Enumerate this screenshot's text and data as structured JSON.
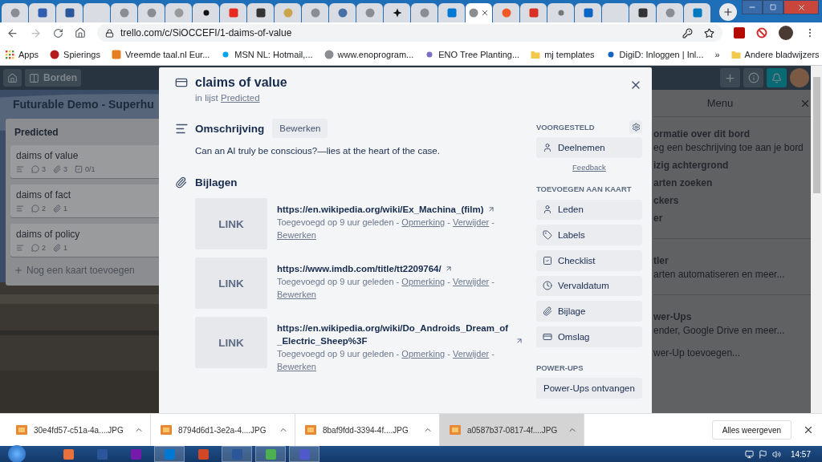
{
  "browser": {
    "tabs": [
      {
        "selected": false
      },
      {
        "selected": false
      },
      {
        "selected": false
      },
      {
        "selected": false
      },
      {
        "selected": false
      },
      {
        "selected": false
      },
      {
        "selected": false
      },
      {
        "selected": false
      },
      {
        "selected": false
      },
      {
        "selected": false
      },
      {
        "selected": false
      },
      {
        "selected": false
      },
      {
        "selected": false
      },
      {
        "selected": false
      },
      {
        "selected": false
      },
      {
        "selected": false
      },
      {
        "selected": false
      },
      {
        "selected": true
      },
      {
        "selected": false
      },
      {
        "selected": false
      },
      {
        "selected": false
      },
      {
        "selected": false
      },
      {
        "selected": false
      },
      {
        "selected": false
      },
      {
        "selected": false
      },
      {
        "selected": false
      }
    ],
    "url": "trello.com/c/SiOCCEFI/1-daims-of-value",
    "bookmarks": [
      "Apps",
      "Spierings",
      "Vreemde taal.nl Eur...",
      "MSN NL: Hotmail,...",
      "www.enoprogram...",
      "ENO Tree Planting...",
      "mj templates",
      "DigiD: Inloggen | Inl..."
    ],
    "more": "»",
    "other_bookmarks": "Andere bladwijzers"
  },
  "board": {
    "nav": {
      "boards": "Borden"
    },
    "title": "Futurable Demo - Superhu",
    "list": {
      "title": "Predicted",
      "cards": [
        {
          "title": "daims of value",
          "badges": [
            {
              "kind": "description"
            },
            {
              "kind": "comments",
              "count": "3"
            },
            {
              "kind": "attachments",
              "count": "3"
            },
            {
              "kind": "checklist",
              "count": "0/1"
            }
          ]
        },
        {
          "title": "daims of fact",
          "badges": [
            {
              "kind": "description"
            },
            {
              "kind": "comments",
              "count": "2"
            },
            {
              "kind": "attachments",
              "count": "1"
            }
          ]
        },
        {
          "title": "daims of policy",
          "badges": [
            {
              "kind": "description"
            },
            {
              "kind": "comments",
              "count": "2"
            },
            {
              "kind": "attachments",
              "count": "1"
            }
          ]
        }
      ],
      "add_card": "Nog een kaart toevoegen"
    }
  },
  "menu": {
    "title": "Menu",
    "sections": [
      {
        "items": [
          {
            "title": "ormatie over dit bord",
            "subtitle": "eg een beschrijving toe aan je bord"
          },
          {
            "title": "izig achtergrond"
          },
          {
            "title": "arten zoeken"
          },
          {
            "title": "ckers"
          },
          {
            "title": "er"
          }
        ]
      },
      {
        "items": [
          {
            "title": "tler",
            "subtitle": "arten automatiseren en meer..."
          }
        ]
      },
      {
        "items": [
          {
            "title": "wer-Ups",
            "subtitle": "ender, Google Drive en meer...",
            "extra": "wer-Up toevoegen..."
          }
        ]
      }
    ]
  },
  "modal": {
    "title": "claims of value",
    "list_prefix": "in lijst",
    "list_link": "Predicted",
    "description": {
      "heading": "Omschrijving",
      "edit": "Bewerken",
      "text": "Can an AI truly be conscious?—lies at the heart of the case."
    },
    "attachments": {
      "heading": "Bijlagen",
      "items": [
        {
          "thumb": "LINK",
          "url": "https://en.wikipedia.org/wiki/Ex_Machina_(film)",
          "meta": [
            {
              "kind": "text",
              "text": "Toegevoegd op 9 uur geleden -"
            },
            {
              "kind": "link",
              "text": "Opmerking"
            },
            {
              "kind": "text",
              "text": "-"
            },
            {
              "kind": "link",
              "text": "Verwijder"
            },
            {
              "kind": "text",
              "text": "-"
            },
            {
              "kind": "link",
              "text": "Bewerken"
            }
          ]
        },
        {
          "thumb": "LINK",
          "url": "https://www.imdb.com/title/tt2209764/",
          "meta": [
            {
              "kind": "text",
              "text": "Toegevoegd op 9 uur geleden -"
            },
            {
              "kind": "link",
              "text": "Opmerking"
            },
            {
              "kind": "text",
              "text": "-"
            },
            {
              "kind": "link",
              "text": "Verwijder"
            },
            {
              "kind": "text",
              "text": "-"
            },
            {
              "kind": "link",
              "text": "Bewerken"
            }
          ]
        },
        {
          "thumb": "LINK",
          "url": "https://en.wikipedia.org/wiki/Do_Androids_Dream_of_Electric_Sheep%3F",
          "meta": [
            {
              "kind": "text",
              "text": "Toegevoegd op 9 uur geleden -"
            },
            {
              "kind": "link",
              "text": "Opmerking"
            },
            {
              "kind": "text",
              "text": "-"
            },
            {
              "kind": "link",
              "text": "Verwijder"
            },
            {
              "kind": "text",
              "text": "-"
            },
            {
              "kind": "link",
              "text": "Bewerken"
            }
          ]
        }
      ]
    },
    "sidebar": [
      {
        "heading": "VOORGESTELD",
        "settings": true,
        "buttons": [
          {
            "kind": "join",
            "label": "Deelnemen"
          }
        ],
        "feedback": "Feedback"
      },
      {
        "heading": "TOEVOEGEN AAN KAART",
        "settings": false,
        "buttons": [
          {
            "kind": "members",
            "label": "Leden"
          },
          {
            "kind": "labels",
            "label": "Labels"
          },
          {
            "kind": "checklist",
            "label": "Checklist"
          },
          {
            "kind": "due",
            "label": "Vervaldatum"
          },
          {
            "kind": "attachment",
            "label": "Bijlage"
          },
          {
            "kind": "cover",
            "label": "Omslag"
          }
        ]
      },
      {
        "heading": "POWER-UPS",
        "settings": false,
        "buttons": [
          {
            "kind": "powerups",
            "label": "Power-Ups ontvangen"
          }
        ]
      }
    ]
  },
  "downloads": {
    "files": [
      {
        "name": "30e4fd57-c51a-4a....JPG",
        "selected": false
      },
      {
        "name": "8794d6d1-3e2a-4....JPG",
        "selected": false
      },
      {
        "name": "8baf9fdd-3394-4f....JPG",
        "selected": false
      },
      {
        "name": "a0587b37-0817-4f....JPG",
        "selected": true
      }
    ],
    "show_all": "Alles weergeven"
  },
  "taskbar": {
    "apps": [
      {
        "open": false
      },
      {
        "open": false
      },
      {
        "open": false
      },
      {
        "open": true
      },
      {
        "open": false
      },
      {
        "open": true
      },
      {
        "open": true
      },
      {
        "open": true
      }
    ],
    "clock": "14:57"
  }
}
